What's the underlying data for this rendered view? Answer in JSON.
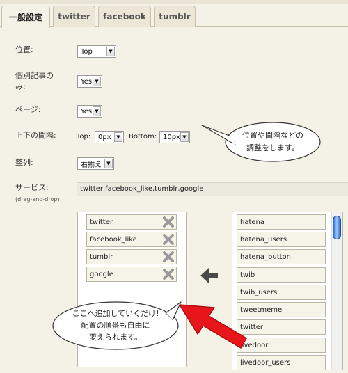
{
  "tabs": [
    {
      "label": "一般設定"
    },
    {
      "label": "twitter"
    },
    {
      "label": "facebook"
    },
    {
      "label": "tumblr"
    }
  ],
  "settings": {
    "position": {
      "label": "位置:",
      "value": "Top"
    },
    "individual": {
      "label_line1": "個別記事の",
      "label_line2": "み:",
      "value": "Yes"
    },
    "page": {
      "label": "ページ:",
      "value": "Yes"
    },
    "spacing": {
      "label": "上下の間隔:",
      "top_label": "Top:",
      "top_value": "0px",
      "bottom_label": "Bottom:",
      "bottom_value": "10px"
    },
    "align": {
      "label": "整列:",
      "value": "右揃え"
    },
    "services": {
      "label": "サービス:",
      "sublabel": "(drag-and-drop)",
      "value": "twitter,facebook_like,tumblr,google"
    }
  },
  "selected_services": [
    "twitter",
    "facebook_like",
    "tumblr",
    "google"
  ],
  "available_services": [
    "hatena",
    "hatena_users",
    "hatena_button",
    "twib",
    "twib_users",
    "tweetmeme",
    "twitter",
    "livedoor",
    "livedoor_users"
  ],
  "annotations": {
    "bubble1_line1": "位置や間隔などの",
    "bubble1_line2": "調整をします。",
    "bubble2_line1": "ここへ追加していくだけ!",
    "bubble2_line2": "配置の順番も自由に",
    "bubble2_line3": "変えられます。"
  },
  "colors": {
    "accent_arrow": "#e8151b",
    "scroll_thumb": "#2a6ad0"
  },
  "icons": {
    "remove": "x-icon",
    "move_left": "left-arrow-icon",
    "select": "chevron-down-icon"
  }
}
